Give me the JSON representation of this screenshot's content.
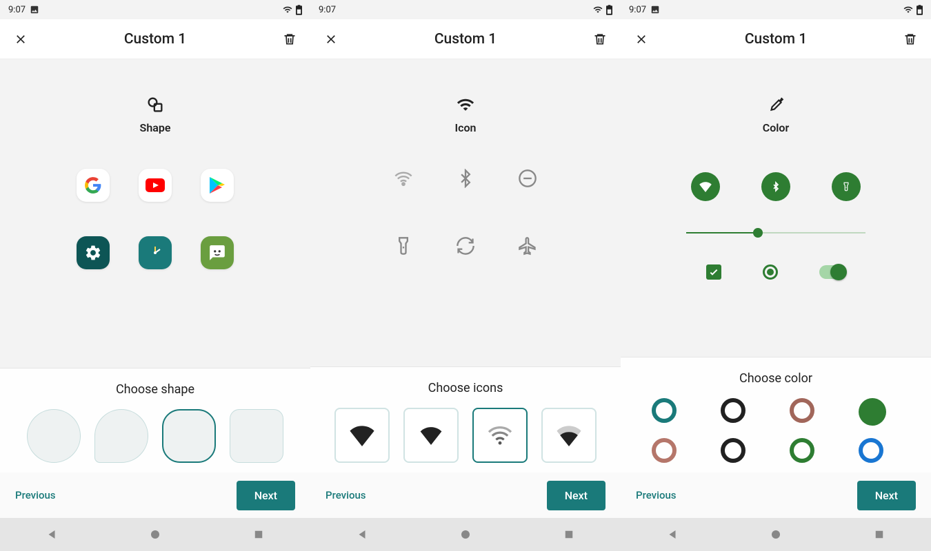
{
  "status": {
    "time": "9:07"
  },
  "header": {
    "title": "Custom 1"
  },
  "panels": [
    {
      "section_title": "Shape",
      "chooser_title": "Choose shape"
    },
    {
      "section_title": "Icon",
      "chooser_title": "Choose icons"
    },
    {
      "section_title": "Color",
      "chooser_title": "Choose color"
    }
  ],
  "footer": {
    "previous": "Previous",
    "next": "Next"
  },
  "colors": {
    "accent_teal": "#1a7a7a",
    "accent_green": "#2e7d32",
    "color_options": [
      "#1a7a7a",
      "#212121",
      "#a1665a",
      "#2e7d32",
      "#b5766a",
      "#212121",
      "#2e7d32",
      "#1976d2"
    ]
  },
  "shape_options": [
    "circle",
    "teardrop",
    "squircle",
    "rounded"
  ],
  "shape_selected": 2,
  "icon_options": [
    "wifi-solid",
    "wifi-solid-small",
    "wifi-outline",
    "wifi-fade"
  ],
  "icon_selected": 2,
  "color_selected": 3,
  "slider_value": 40,
  "preview_apps": [
    "google",
    "youtube",
    "play",
    "settings",
    "clock",
    "messages"
  ],
  "preview_icons": [
    "wifi",
    "bluetooth",
    "dnd",
    "flashlight",
    "sync",
    "airplane"
  ],
  "color_samples": [
    "wifi-tile",
    "bluetooth-tile",
    "flashlight-tile"
  ]
}
